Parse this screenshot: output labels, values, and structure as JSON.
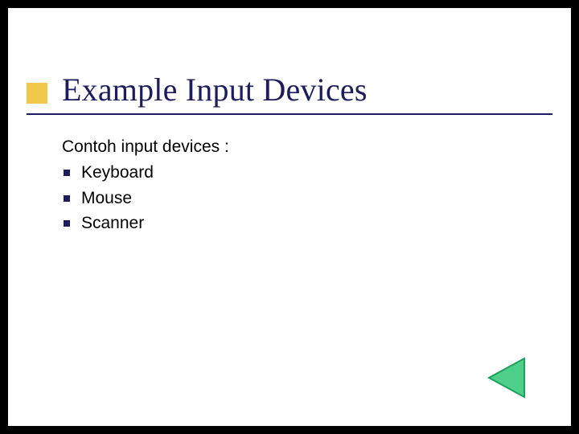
{
  "slide": {
    "title": "Example Input Devices",
    "intro": "Contoh input devices :",
    "bullets": [
      "Keyboard",
      "Mouse",
      "Scanner"
    ]
  }
}
